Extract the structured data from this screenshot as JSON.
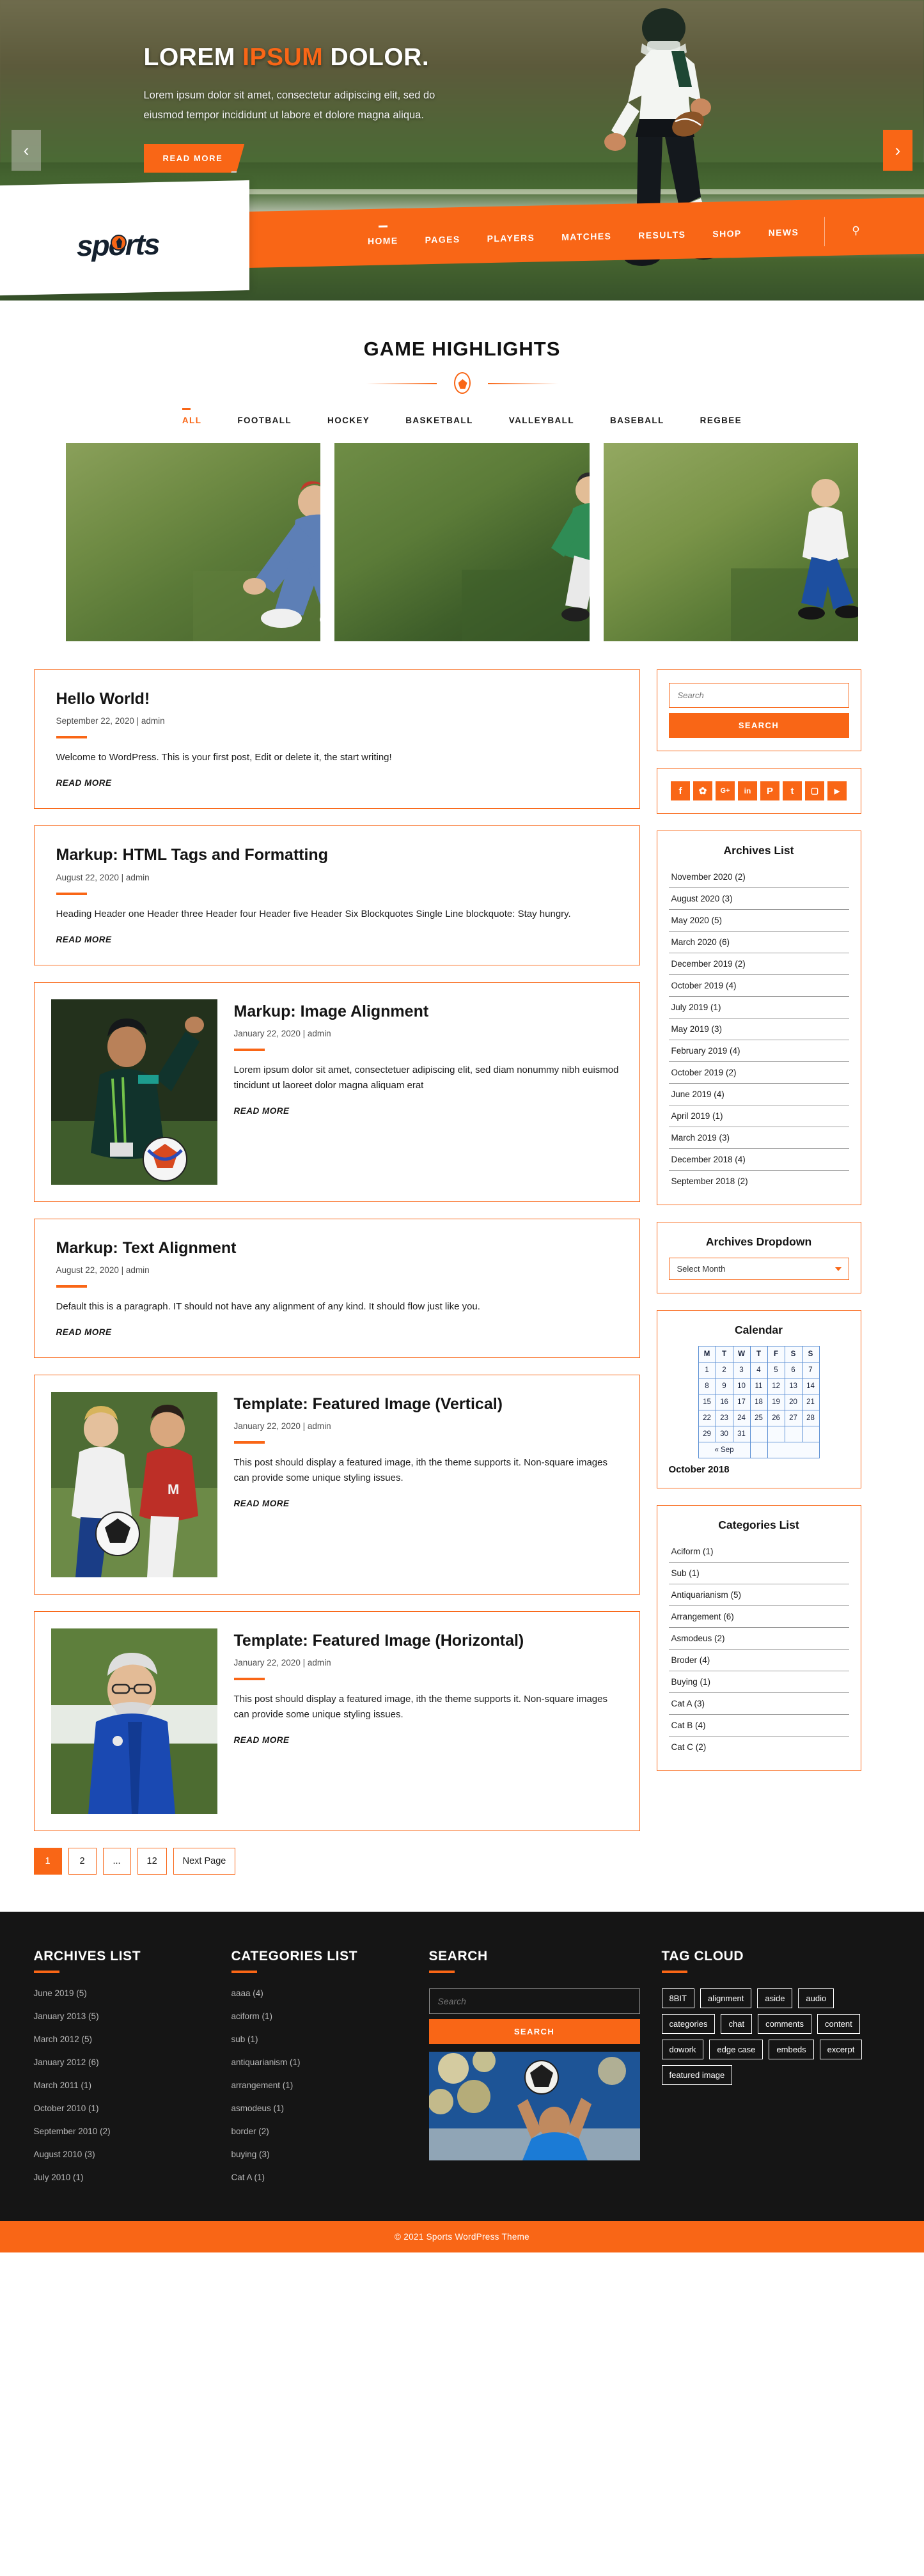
{
  "hero": {
    "title_1": "LOREM ",
    "title_accent": "IPSUM",
    "title_2": " DOLOR.",
    "subtitle": "Lorem ipsum dolor sit amet, consectetur adipiscing elit, sed do eiusmod tempor incididunt ut labore et dolore magna aliqua.",
    "cta": "READ MORE",
    "prev_icon": "chevron-left",
    "next_icon": "chevron-right"
  },
  "header": {
    "logo": "sports",
    "nav": [
      {
        "label": "HOME",
        "active": true
      },
      {
        "label": "PAGES",
        "active": false
      },
      {
        "label": "PLAYERS",
        "active": false
      },
      {
        "label": "MATCHES",
        "active": false
      },
      {
        "label": "RESULTS",
        "active": false
      },
      {
        "label": "SHOP",
        "active": false
      },
      {
        "label": "NEWS",
        "active": false
      }
    ],
    "search_icon": "search-icon"
  },
  "highlights": {
    "title": "GAME HIGHLIGHTS",
    "filters": [
      "ALL",
      "FOOTBALL",
      "HOCKEY",
      "BASKETBALL",
      "VALLEYBALL",
      "BASEBALL",
      "REGBEE"
    ],
    "active_filter": "ALL"
  },
  "posts": [
    {
      "title": "Hello World!",
      "meta": "September 22, 2020 | admin",
      "text": "Welcome to WordPress. This is your first post, Edit or delete it, the start writing!",
      "read_more": "READ MORE",
      "has_image": false
    },
    {
      "title": "Markup: HTML Tags and Formatting",
      "meta": "August 22, 2020 | admin",
      "text": "Heading Header one Header three Header four Header five Header Six Blockquotes Single Line blockquote: Stay hungry.",
      "read_more": "READ MORE",
      "has_image": false
    },
    {
      "title": "Markup: Image Alignment",
      "meta": "January 22, 2020 | admin",
      "text": "Lorem ipsum dolor sit amet, consectetuer adipiscing elit, sed diam nonummy nibh euismod tincidunt ut laoreet dolor magna aliquam erat",
      "read_more": "READ MORE",
      "has_image": true
    },
    {
      "title": "Markup: Text Alignment",
      "meta": "August 22, 2020 | admin",
      "text": "Default this is a paragraph. IT should not have any alignment of any kind. It should flow just like you.",
      "read_more": "READ MORE",
      "has_image": false
    },
    {
      "title": "Template: Featured Image (Vertical)",
      "meta": "January 22, 2020 | admin",
      "text": "This post should display a featured image, ith the theme supports it. Non-square images can provide some unique styling issues.",
      "read_more": "READ MORE",
      "has_image": true
    },
    {
      "title": "Template: Featured Image (Horizontal)",
      "meta": "January 22, 2020 | admin",
      "text": "This post should display a featured image, ith the theme supports it. Non-square images can provide some unique styling issues.",
      "read_more": "READ MORE",
      "has_image": true
    }
  ],
  "pagination": [
    "1",
    "2",
    "...",
    "12",
    "Next Page"
  ],
  "pagination_active": "1",
  "sidebar": {
    "search": {
      "placeholder": "Search",
      "button": "SEARCH"
    },
    "social": [
      {
        "name": "facebook",
        "glyph": "f"
      },
      {
        "name": "twitter",
        "glyph": "🐦"
      },
      {
        "name": "google-plus",
        "glyph": "G+"
      },
      {
        "name": "linkedin",
        "glyph": "in"
      },
      {
        "name": "pinterest",
        "glyph": "P"
      },
      {
        "name": "tumblr",
        "glyph": "t"
      },
      {
        "name": "instagram",
        "glyph": "▢"
      },
      {
        "name": "youtube",
        "glyph": "▶"
      }
    ],
    "archives_title": "Archives List",
    "archives": [
      "November 2020 (2)",
      "August 2020 (3)",
      "May 2020 (5)",
      "March 2020 (6)",
      "December 2019 (2)",
      "October 2019 (4)",
      "July 2019 (1)",
      "May 2019 (3)",
      "February 2019 (4)",
      "October 2019 (2)",
      "June 2019 (4)",
      "April 2019 (1)",
      "March 2019 (3)",
      "December 2018 (4)",
      "September 2018 (2)"
    ],
    "dropdown_title": "Archives Dropdown",
    "dropdown_value": "Select Month",
    "calendar": {
      "title": "Calendar",
      "headers": [
        "M",
        "T",
        "W",
        "T",
        "F",
        "S",
        "S"
      ],
      "weeks": [
        [
          "1",
          "2",
          "3",
          "4",
          "5",
          "6",
          "7"
        ],
        [
          "8",
          "9",
          "10",
          "11",
          "12",
          "13",
          "14"
        ],
        [
          "15",
          "16",
          "17",
          "18",
          "19",
          "20",
          "21"
        ],
        [
          "22",
          "23",
          "24",
          "25",
          "26",
          "27",
          "28"
        ],
        [
          "29",
          "30",
          "31",
          "",
          "",
          "",
          ""
        ]
      ],
      "prev": "« Sep",
      "caption": "October 2018"
    },
    "categories_title": "Categories List",
    "categories": [
      "Aciform (1)",
      "Sub (1)",
      "Antiquarianism (5)",
      "Arrangement (6)",
      "Asmodeus (2)",
      "Broder (4)",
      "Buying (1)",
      "Cat A (3)",
      "Cat B (4)",
      "Cat C (2)"
    ]
  },
  "footer": {
    "archives_title": "ARCHIVES LIST",
    "archives": [
      "June 2019 (5)",
      "January  2013 (5)",
      "March 2012 (5)",
      "January  2012 (6)",
      "March  2011 (1)",
      "October 2010 (1)",
      "September 2010 (2)",
      "August 2010 (3)",
      "July 2010 (1)"
    ],
    "categories_title": "CATEGORIES LIST",
    "categories": [
      "aaaa (4)",
      "aciform (1)",
      "sub (1)",
      "antiquarianism (1)",
      "arrangement (1)",
      "asmodeus (1)",
      "border (2)",
      "buying (3)",
      "Cat A (1)"
    ],
    "search_title": "SEARCH",
    "search_placeholder": "Search",
    "search_button": "SEARCH",
    "tag_title": "TAG CLOUD",
    "tags": [
      "8BIT",
      "alignment",
      "aside",
      "audio",
      "categories",
      "chat",
      "comments",
      "content",
      "dowork",
      "edge case",
      "embeds",
      "excerpt",
      "featured image"
    ],
    "copyright": "© 2021 Sports WordPress Theme"
  },
  "colors": {
    "accent": "#f96616",
    "dark": "#151515",
    "calendar_border": "#5b8fd4"
  }
}
